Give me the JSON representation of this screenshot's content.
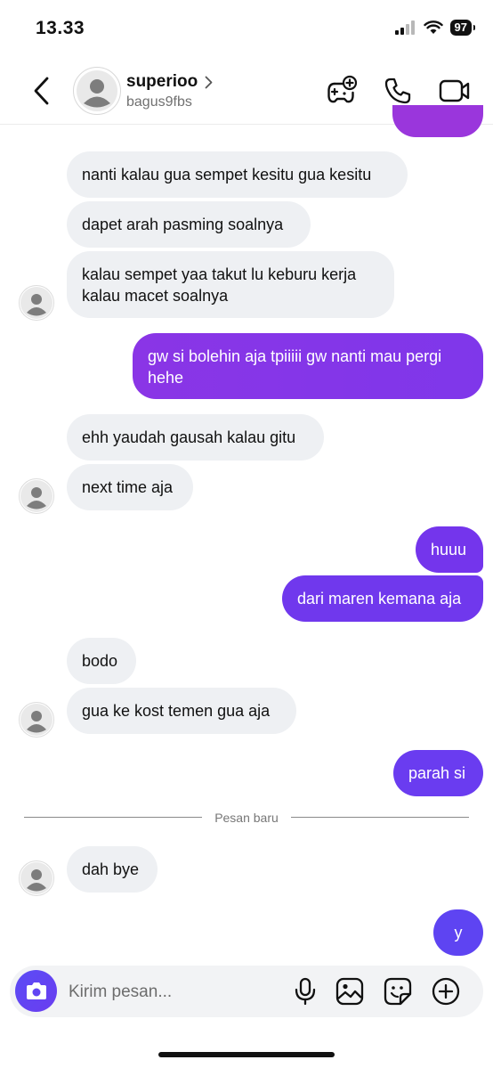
{
  "status_bar": {
    "time": "13.33",
    "battery": "97"
  },
  "header": {
    "display_name": "superioo",
    "username": "bagus9fbs"
  },
  "messages": [
    {
      "from": "them",
      "text": "nanti kalau gua sempet kesitu gua kesitu"
    },
    {
      "from": "them",
      "text": "dapet arah pasming soalnya"
    },
    {
      "from": "them",
      "text": "kalau sempet yaa takut lu keburu kerja\nkalau macet soalnya"
    },
    {
      "from": "me",
      "text": "gw si bolehin aja tpiiiii gw nanti mau pergi\nhehe"
    },
    {
      "from": "them",
      "text": "ehh yaudah gausah kalau gitu"
    },
    {
      "from": "them",
      "text": "next time aja"
    },
    {
      "from": "me",
      "text": "huuu"
    },
    {
      "from": "me",
      "text": "dari maren kemana aja"
    },
    {
      "from": "them",
      "text": "bodo"
    },
    {
      "from": "them",
      "text": "gua ke kost temen gua aja"
    },
    {
      "from": "me",
      "text": "parah si"
    },
    {
      "from": "them",
      "text": "dah bye"
    },
    {
      "from": "me",
      "text": "y"
    }
  ],
  "divider": {
    "label": "Pesan baru"
  },
  "composer": {
    "placeholder": "Kirim pesan..."
  },
  "colors": {
    "received_bubble": "#eef0f3",
    "sent_purple": "#8a35e6",
    "sent_indigo": "#6b3df2",
    "accent": "#5b4cf5"
  },
  "icons": {
    "back": "chevron-left-icon",
    "profile_chevron": "chevron-right-icon",
    "effects": "game-controller-plus-icon",
    "call": "phone-icon",
    "video": "video-camera-icon",
    "camera": "camera-icon",
    "mic": "microphone-icon",
    "gallery": "image-icon",
    "sticker": "sticker-icon",
    "add": "plus-circle-icon"
  }
}
